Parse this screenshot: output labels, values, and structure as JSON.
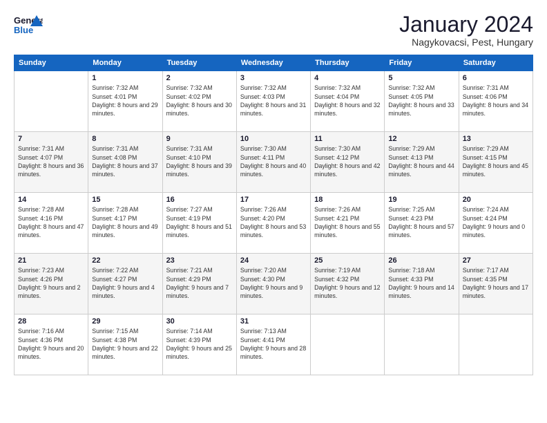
{
  "logo": {
    "line1": "General",
    "line2": "Blue"
  },
  "title": "January 2024",
  "location": "Nagykovacsi, Pest, Hungary",
  "weekdays": [
    "Sunday",
    "Monday",
    "Tuesday",
    "Wednesday",
    "Thursday",
    "Friday",
    "Saturday"
  ],
  "weeks": [
    [
      {
        "day": "",
        "sunrise": "",
        "sunset": "",
        "daylight": ""
      },
      {
        "day": "1",
        "sunrise": "Sunrise: 7:32 AM",
        "sunset": "Sunset: 4:01 PM",
        "daylight": "Daylight: 8 hours and 29 minutes."
      },
      {
        "day": "2",
        "sunrise": "Sunrise: 7:32 AM",
        "sunset": "Sunset: 4:02 PM",
        "daylight": "Daylight: 8 hours and 30 minutes."
      },
      {
        "day": "3",
        "sunrise": "Sunrise: 7:32 AM",
        "sunset": "Sunset: 4:03 PM",
        "daylight": "Daylight: 8 hours and 31 minutes."
      },
      {
        "day": "4",
        "sunrise": "Sunrise: 7:32 AM",
        "sunset": "Sunset: 4:04 PM",
        "daylight": "Daylight: 8 hours and 32 minutes."
      },
      {
        "day": "5",
        "sunrise": "Sunrise: 7:32 AM",
        "sunset": "Sunset: 4:05 PM",
        "daylight": "Daylight: 8 hours and 33 minutes."
      },
      {
        "day": "6",
        "sunrise": "Sunrise: 7:31 AM",
        "sunset": "Sunset: 4:06 PM",
        "daylight": "Daylight: 8 hours and 34 minutes."
      }
    ],
    [
      {
        "day": "7",
        "sunrise": "Sunrise: 7:31 AM",
        "sunset": "Sunset: 4:07 PM",
        "daylight": "Daylight: 8 hours and 36 minutes."
      },
      {
        "day": "8",
        "sunrise": "Sunrise: 7:31 AM",
        "sunset": "Sunset: 4:08 PM",
        "daylight": "Daylight: 8 hours and 37 minutes."
      },
      {
        "day": "9",
        "sunrise": "Sunrise: 7:31 AM",
        "sunset": "Sunset: 4:10 PM",
        "daylight": "Daylight: 8 hours and 39 minutes."
      },
      {
        "day": "10",
        "sunrise": "Sunrise: 7:30 AM",
        "sunset": "Sunset: 4:11 PM",
        "daylight": "Daylight: 8 hours and 40 minutes."
      },
      {
        "day": "11",
        "sunrise": "Sunrise: 7:30 AM",
        "sunset": "Sunset: 4:12 PM",
        "daylight": "Daylight: 8 hours and 42 minutes."
      },
      {
        "day": "12",
        "sunrise": "Sunrise: 7:29 AM",
        "sunset": "Sunset: 4:13 PM",
        "daylight": "Daylight: 8 hours and 44 minutes."
      },
      {
        "day": "13",
        "sunrise": "Sunrise: 7:29 AM",
        "sunset": "Sunset: 4:15 PM",
        "daylight": "Daylight: 8 hours and 45 minutes."
      }
    ],
    [
      {
        "day": "14",
        "sunrise": "Sunrise: 7:28 AM",
        "sunset": "Sunset: 4:16 PM",
        "daylight": "Daylight: 8 hours and 47 minutes."
      },
      {
        "day": "15",
        "sunrise": "Sunrise: 7:28 AM",
        "sunset": "Sunset: 4:17 PM",
        "daylight": "Daylight: 8 hours and 49 minutes."
      },
      {
        "day": "16",
        "sunrise": "Sunrise: 7:27 AM",
        "sunset": "Sunset: 4:19 PM",
        "daylight": "Daylight: 8 hours and 51 minutes."
      },
      {
        "day": "17",
        "sunrise": "Sunrise: 7:26 AM",
        "sunset": "Sunset: 4:20 PM",
        "daylight": "Daylight: 8 hours and 53 minutes."
      },
      {
        "day": "18",
        "sunrise": "Sunrise: 7:26 AM",
        "sunset": "Sunset: 4:21 PM",
        "daylight": "Daylight: 8 hours and 55 minutes."
      },
      {
        "day": "19",
        "sunrise": "Sunrise: 7:25 AM",
        "sunset": "Sunset: 4:23 PM",
        "daylight": "Daylight: 8 hours and 57 minutes."
      },
      {
        "day": "20",
        "sunrise": "Sunrise: 7:24 AM",
        "sunset": "Sunset: 4:24 PM",
        "daylight": "Daylight: 9 hours and 0 minutes."
      }
    ],
    [
      {
        "day": "21",
        "sunrise": "Sunrise: 7:23 AM",
        "sunset": "Sunset: 4:26 PM",
        "daylight": "Daylight: 9 hours and 2 minutes."
      },
      {
        "day": "22",
        "sunrise": "Sunrise: 7:22 AM",
        "sunset": "Sunset: 4:27 PM",
        "daylight": "Daylight: 9 hours and 4 minutes."
      },
      {
        "day": "23",
        "sunrise": "Sunrise: 7:21 AM",
        "sunset": "Sunset: 4:29 PM",
        "daylight": "Daylight: 9 hours and 7 minutes."
      },
      {
        "day": "24",
        "sunrise": "Sunrise: 7:20 AM",
        "sunset": "Sunset: 4:30 PM",
        "daylight": "Daylight: 9 hours and 9 minutes."
      },
      {
        "day": "25",
        "sunrise": "Sunrise: 7:19 AM",
        "sunset": "Sunset: 4:32 PM",
        "daylight": "Daylight: 9 hours and 12 minutes."
      },
      {
        "day": "26",
        "sunrise": "Sunrise: 7:18 AM",
        "sunset": "Sunset: 4:33 PM",
        "daylight": "Daylight: 9 hours and 14 minutes."
      },
      {
        "day": "27",
        "sunrise": "Sunrise: 7:17 AM",
        "sunset": "Sunset: 4:35 PM",
        "daylight": "Daylight: 9 hours and 17 minutes."
      }
    ],
    [
      {
        "day": "28",
        "sunrise": "Sunrise: 7:16 AM",
        "sunset": "Sunset: 4:36 PM",
        "daylight": "Daylight: 9 hours and 20 minutes."
      },
      {
        "day": "29",
        "sunrise": "Sunrise: 7:15 AM",
        "sunset": "Sunset: 4:38 PM",
        "daylight": "Daylight: 9 hours and 22 minutes."
      },
      {
        "day": "30",
        "sunrise": "Sunrise: 7:14 AM",
        "sunset": "Sunset: 4:39 PM",
        "daylight": "Daylight: 9 hours and 25 minutes."
      },
      {
        "day": "31",
        "sunrise": "Sunrise: 7:13 AM",
        "sunset": "Sunset: 4:41 PM",
        "daylight": "Daylight: 9 hours and 28 minutes."
      },
      {
        "day": "",
        "sunrise": "",
        "sunset": "",
        "daylight": ""
      },
      {
        "day": "",
        "sunrise": "",
        "sunset": "",
        "daylight": ""
      },
      {
        "day": "",
        "sunrise": "",
        "sunset": "",
        "daylight": ""
      }
    ]
  ]
}
